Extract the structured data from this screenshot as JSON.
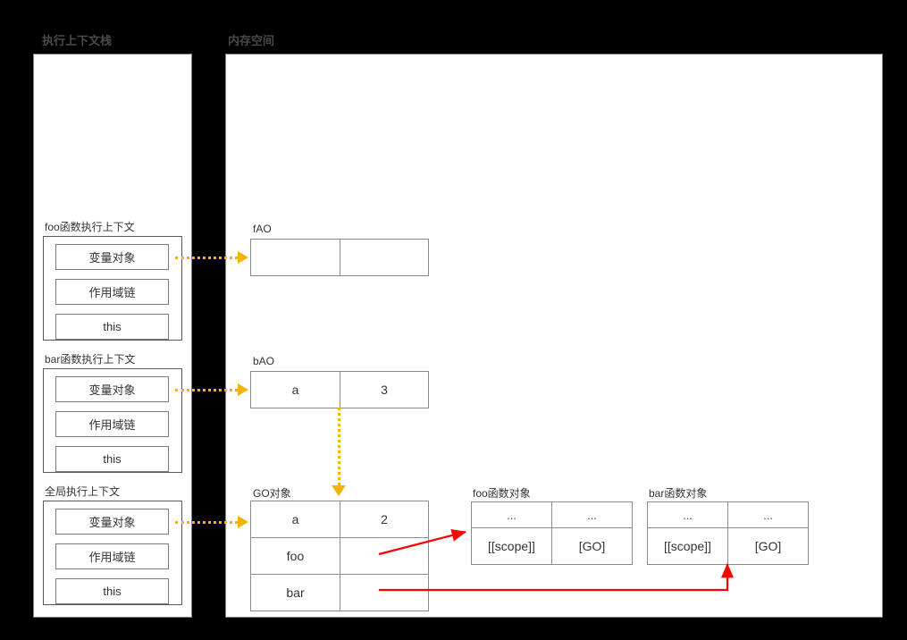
{
  "panels": {
    "stack": {
      "title": "执行上下文栈"
    },
    "memory": {
      "title": "内存空间"
    }
  },
  "colors": {
    "background": "#000000",
    "panel_fill": "#ffffff",
    "panel_border": "#808080",
    "text": "#333333",
    "dotted_arrow": "#f5b301",
    "red_arrow": "#ff0000"
  },
  "execution_contexts": [
    {
      "label": "foo函数执行上下文",
      "cells": [
        "变量对象",
        "作用域链",
        "this"
      ]
    },
    {
      "label": "bar函数执行上下文",
      "cells": [
        "变量对象",
        "作用域链",
        "this"
      ]
    },
    {
      "label": "全局执行上下文",
      "cells": [
        "变量对象",
        "作用域链",
        "this"
      ]
    }
  ],
  "memory_objects": {
    "fao": {
      "label": "fAO",
      "rows": [
        {
          "key": "",
          "value": ""
        }
      ]
    },
    "bao": {
      "label": "bAO",
      "rows": [
        {
          "key": "a",
          "value": "3"
        }
      ]
    },
    "go": {
      "label": "GO对象",
      "rows": [
        {
          "key": "a",
          "value": "2"
        },
        {
          "key": "foo",
          "value": ""
        },
        {
          "key": "bar",
          "value": ""
        }
      ]
    },
    "foo_function_object": {
      "label": "foo函数对象",
      "rows": [
        {
          "key": "...",
          "value": "..."
        },
        {
          "key": "[[scope]]",
          "value": "[GO]"
        }
      ]
    },
    "bar_function_object": {
      "label": "bar函数对象",
      "rows": [
        {
          "key": "...",
          "value": "..."
        },
        {
          "key": "[[scope]]",
          "value": "[GO]"
        }
      ]
    }
  }
}
